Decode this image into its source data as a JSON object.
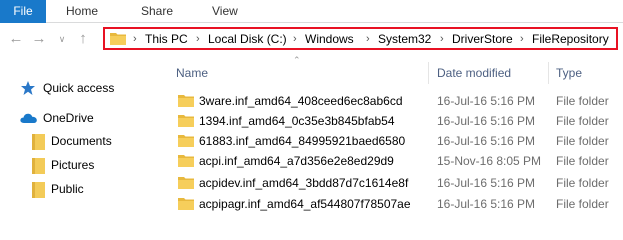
{
  "ribbon": {
    "file_label": "File",
    "tabs": [
      "Home",
      "Share",
      "View"
    ]
  },
  "nav_buttons": {
    "back": "back-icon",
    "forward": "forward-icon",
    "recent": "chevron-down-icon",
    "up": "up-arrow-icon"
  },
  "address_bar": {
    "crumbs": [
      "This PC",
      "Local Disk (C:)",
      "Windows",
      "System32",
      "DriverStore",
      "FileRepository"
    ],
    "highlight_color": "#e81123"
  },
  "columns": {
    "name": "Name",
    "date": "Date modified",
    "type": "Type"
  },
  "nav_pane": {
    "items": [
      {
        "label": "Quick access",
        "icon": "star-icon"
      },
      {
        "label": "OneDrive",
        "icon": "cloud-icon"
      },
      {
        "label": "Documents",
        "icon": "folder-icon"
      },
      {
        "label": "Pictures",
        "icon": "folder-icon"
      },
      {
        "label": "Public",
        "icon": "folder-icon"
      }
    ]
  },
  "files": [
    {
      "name": "3ware.inf_amd64_408ceed6ec8ab6cd",
      "date": "16-Jul-16 5:16 PM",
      "type": "File folder"
    },
    {
      "name": "1394.inf_amd64_0c35e3b845bfab54",
      "date": "16-Jul-16 5:16 PM",
      "type": "File folder"
    },
    {
      "name": "61883.inf_amd64_84995921baed6580",
      "date": "16-Jul-16 5:16 PM",
      "type": "File folder"
    },
    {
      "name": "acpi.inf_amd64_a7d356e2e8ed29d9",
      "date": "15-Nov-16 8:05 PM",
      "type": "File folder"
    },
    {
      "name": "acpidev.inf_amd64_3bdd87d7c1614e8f",
      "date": "16-Jul-16 5:16 PM",
      "type": "File folder"
    },
    {
      "name": "acpipagr.inf_amd64_af544807f78507ae",
      "date": "16-Jul-16 5:16 PM",
      "type": "File folder"
    }
  ],
  "colors": {
    "file_tab": "#1979ca",
    "folder": "#e8b93e",
    "header_text": "#4d6082"
  }
}
